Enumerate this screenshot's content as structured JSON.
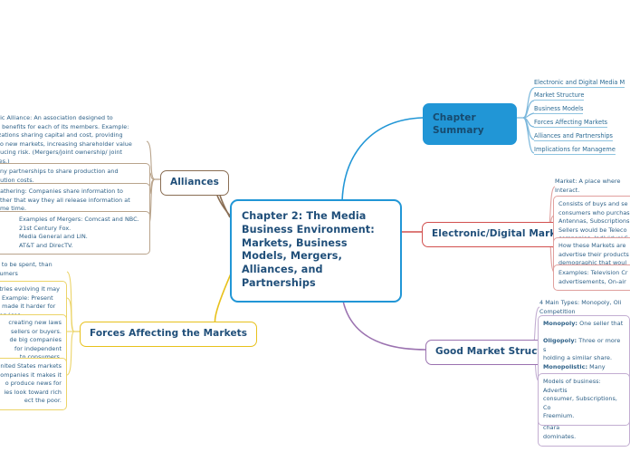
{
  "central": {
    "title": "Chapter 2: The Media Business Environment: Markets, Business Models, Mergers, Alliances, and Partnerships",
    "border_color": "#2196d6"
  },
  "branches": {
    "summary": {
      "label": "Chapter Summary",
      "color": "#2196d6",
      "leaves": [
        "Electronic and Digital Media M",
        "Market Structure",
        "Business Models",
        "Forces Affecting Markets",
        "Alliances and Partnerships",
        "Implications for Manageme"
      ]
    },
    "electronic": {
      "label": "Electronic/Digital Markets",
      "color": "#d2504f",
      "leaves": [
        "Market: A place where \nInteract.",
        "Consists of buys and se\nconsumers who purchas\nAntennas, Subscriptions\nSellers would be Teleco\ncompanies, Individual S",
        "How these Markets are\nadvertise their products\ndemographic that woul",
        "Examples: Television Cr\nadvertisements, On-air"
      ]
    },
    "good_market": {
      "label": "Good Market Structure",
      "color": "#9b72b0",
      "leaves": [
        "4 Main Types: Monopoly, Oli\nCompetition",
        "Monopoly: One seller that  \nOligopoly: Three or more s\nholding a similar share.\nMonopolistic: Many sellers\nthat are not perfect substitu\nPerfect Competition: Mult\nhomogeneous product chara\ndominates.",
        "Models of business: Advertis\nconsumer, Subscriptions, Co\nFreemium."
      ]
    },
    "alliances": {
      "label": "Alliances",
      "color": "#8a6e54",
      "leaves": [
        "egic Alliance: An association designed to\nde benefits for each of its members. Example:\nnizations sharing capital and cost, providing\ns to new markets, increasing shareholder value\neducing risk. (Mergers/joint ownership/ joint\nures.)",
        "any partnerships to share production and\nbution costs.",
        "gathering: Companies share information to\nother that way they all release information at\name time.",
        "Examples of Mergers: Comcast and NBC.\n21st Century Fox.\nMedia General and LIN.\nAT&T and DirecTV."
      ]
    },
    "forces": {
      "label": "Forces Affecting the Markets",
      "color": "#e8c11c",
      "leaves": [
        "ey to be spent, than\nnsumers",
        "stries evolving it may\nl. Example: Present\ne made it harder for\nservices.",
        "creating new laws\nsellers or buyers.\nde big companies\nfor independent\nto consumers.",
        "nited States markets\nompanies it makes it\no produce news for\nies look toward rich\nect the poor."
      ]
    }
  }
}
